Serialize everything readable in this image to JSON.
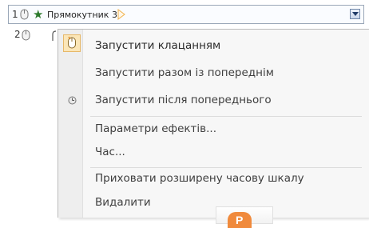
{
  "animation_pane": {
    "row1": {
      "number": "1",
      "label": "Прямокутник 3"
    },
    "row2": {
      "number": "2"
    }
  },
  "context_menu": {
    "items": [
      {
        "label": "Запустити клацанням"
      },
      {
        "label": "Запустити разом із попереднім"
      },
      {
        "label": "Запустити після попереднього"
      },
      {
        "label": "Параметри ефектів..."
      },
      {
        "label": "Час..."
      },
      {
        "label": "Приховати розширену часову шкалу"
      },
      {
        "label": "Видалити"
      }
    ]
  },
  "icons": {
    "effect_icon": "green-star-icon",
    "trigger_icon": "mouse-icon",
    "after_previous_icon": "clock-icon",
    "app_logo": "powerpoint-logo"
  },
  "colors": {
    "highlight": "#fbe6b8",
    "star": "#2c7a2c",
    "logo": "#f08a3c"
  }
}
